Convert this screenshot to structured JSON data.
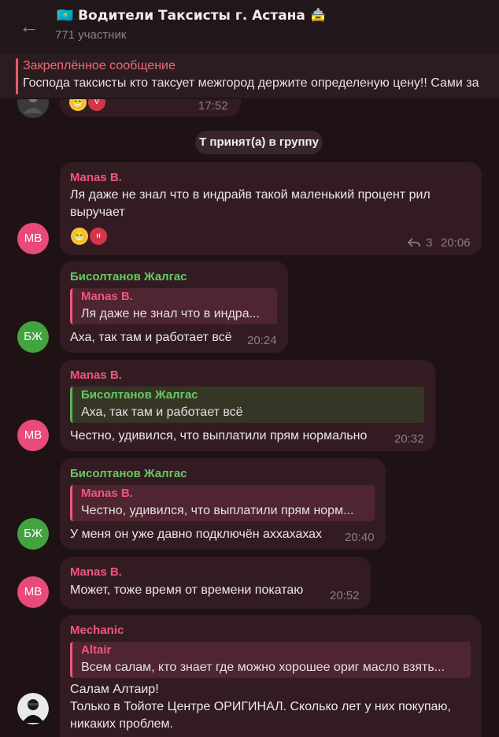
{
  "header": {
    "back_icon": "←",
    "title": "🇰🇿 Водители Таксисты г. Астана 🚖",
    "subtitle": "771 участник"
  },
  "pinned": {
    "title": "Закреплённое сообщение",
    "text": "Господа таксисты кто таксует межгород держите определеную цену!! Сами за"
  },
  "prev_message": {
    "reaction_emoji": "😁",
    "reaction_user": "V",
    "time": "17:52"
  },
  "service_message": "Т принят(а) в группу",
  "messages": [
    {
      "avatar": "MB",
      "name": "Manas B.",
      "lines": [
        "Ля даже не знал что в индрайв такой маленький процент рил",
        "выручает"
      ],
      "reaction_emoji": "😁",
      "reaction_user": "н",
      "replies_count": "3",
      "time": "20:06"
    },
    {
      "avatar": "БЖ",
      "name": "Бисолтанов Жалгас",
      "reply_name": "Manas B.",
      "reply_text": "Ля даже не знал что в индра...",
      "text": "Аха, так там и работает всё",
      "time": "20:24"
    },
    {
      "avatar": "MB",
      "name": "Manas B.",
      "reply_name": "Бисолтанов Жалгас",
      "reply_text": "Аха, так там и работает всё",
      "text": "Честно, удивился, что выплатили прям нормально",
      "time": "20:32"
    },
    {
      "avatar": "БЖ",
      "name": "Бисолтанов Жалгас",
      "reply_name": "Manas B.",
      "reply_text": "Честно, удивился, что выплатили прям норм...",
      "text": "У меня он уже давно подключён аххахахах",
      "time": "20:40"
    },
    {
      "avatar": "MB",
      "name": "Manas B.",
      "text": "Может, тоже время от времени покатаю",
      "time": "20:52"
    },
    {
      "name": "Mechanic",
      "reply_name": "Altair",
      "reply_text": "Всем салам, кто знает где можно хорошее ориг масло взять...",
      "lines": [
        "Салам Алтаир!",
        "Только в Тойоте Центре ОРИГИНАЛ. Сколько лет у них покупаю,",
        "никаких проблем."
      ]
    }
  ],
  "colors": {
    "background": "#1e1214",
    "bubble": "#321c21",
    "accent_pink": "#f0567e",
    "accent_green": "#66c963",
    "pinned_accent": "#f06a78"
  }
}
